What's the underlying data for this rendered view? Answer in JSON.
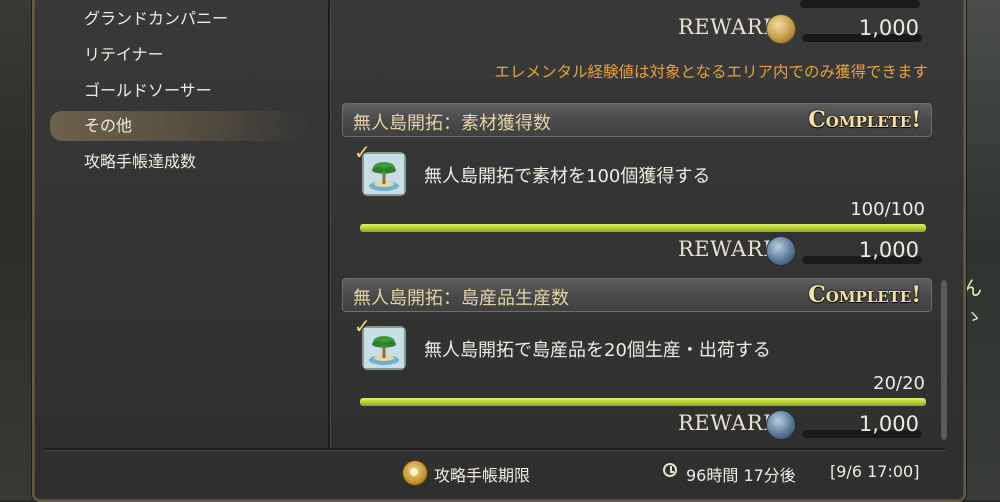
{
  "sidebar": {
    "items": [
      {
        "label": "グランドカンパニー"
      },
      {
        "label": "リテイナー"
      },
      {
        "label": "ゴールドソーサー"
      },
      {
        "label": "その他",
        "selected": true
      },
      {
        "label": "攻略手帳達成数"
      }
    ]
  },
  "top_reward": {
    "label": "Reward",
    "icon": "gil-coin-icon",
    "value": "1,000"
  },
  "notice": "エレメンタル経験値は対象となるエリア内でのみ獲得できます",
  "achievements": [
    {
      "title": "無人島開拓：素材獲得数",
      "status": "Complete!",
      "icon": "island-icon",
      "description": "無人島開拓で素材を100個獲得する",
      "progress_text": "100/100",
      "progress_fraction": 1.0,
      "reward_label": "Reward",
      "reward_icon": "seafarer-cowrie-icon",
      "reward_value": "1,000"
    },
    {
      "title": "無人島開拓：島産品生産数",
      "status": "Complete!",
      "icon": "island-icon",
      "description": "無人島開拓で島産品を20個生産・出荷する",
      "progress_text": "20/20",
      "progress_fraction": 1.0,
      "reward_label": "Reward",
      "reward_icon": "seafarer-cowrie-icon",
      "reward_value": "1,000"
    }
  ],
  "footer": {
    "label": "攻略手帳期限",
    "time_remaining": "96時間 17分後",
    "deadline": "[9/6 17:00]"
  },
  "background_chat": [
    "ん",
    "ゝ"
  ],
  "colors": {
    "accent_gold": "#e6d2a6",
    "notice_orange": "#e8a23a",
    "progress_green": "#b8d232"
  }
}
